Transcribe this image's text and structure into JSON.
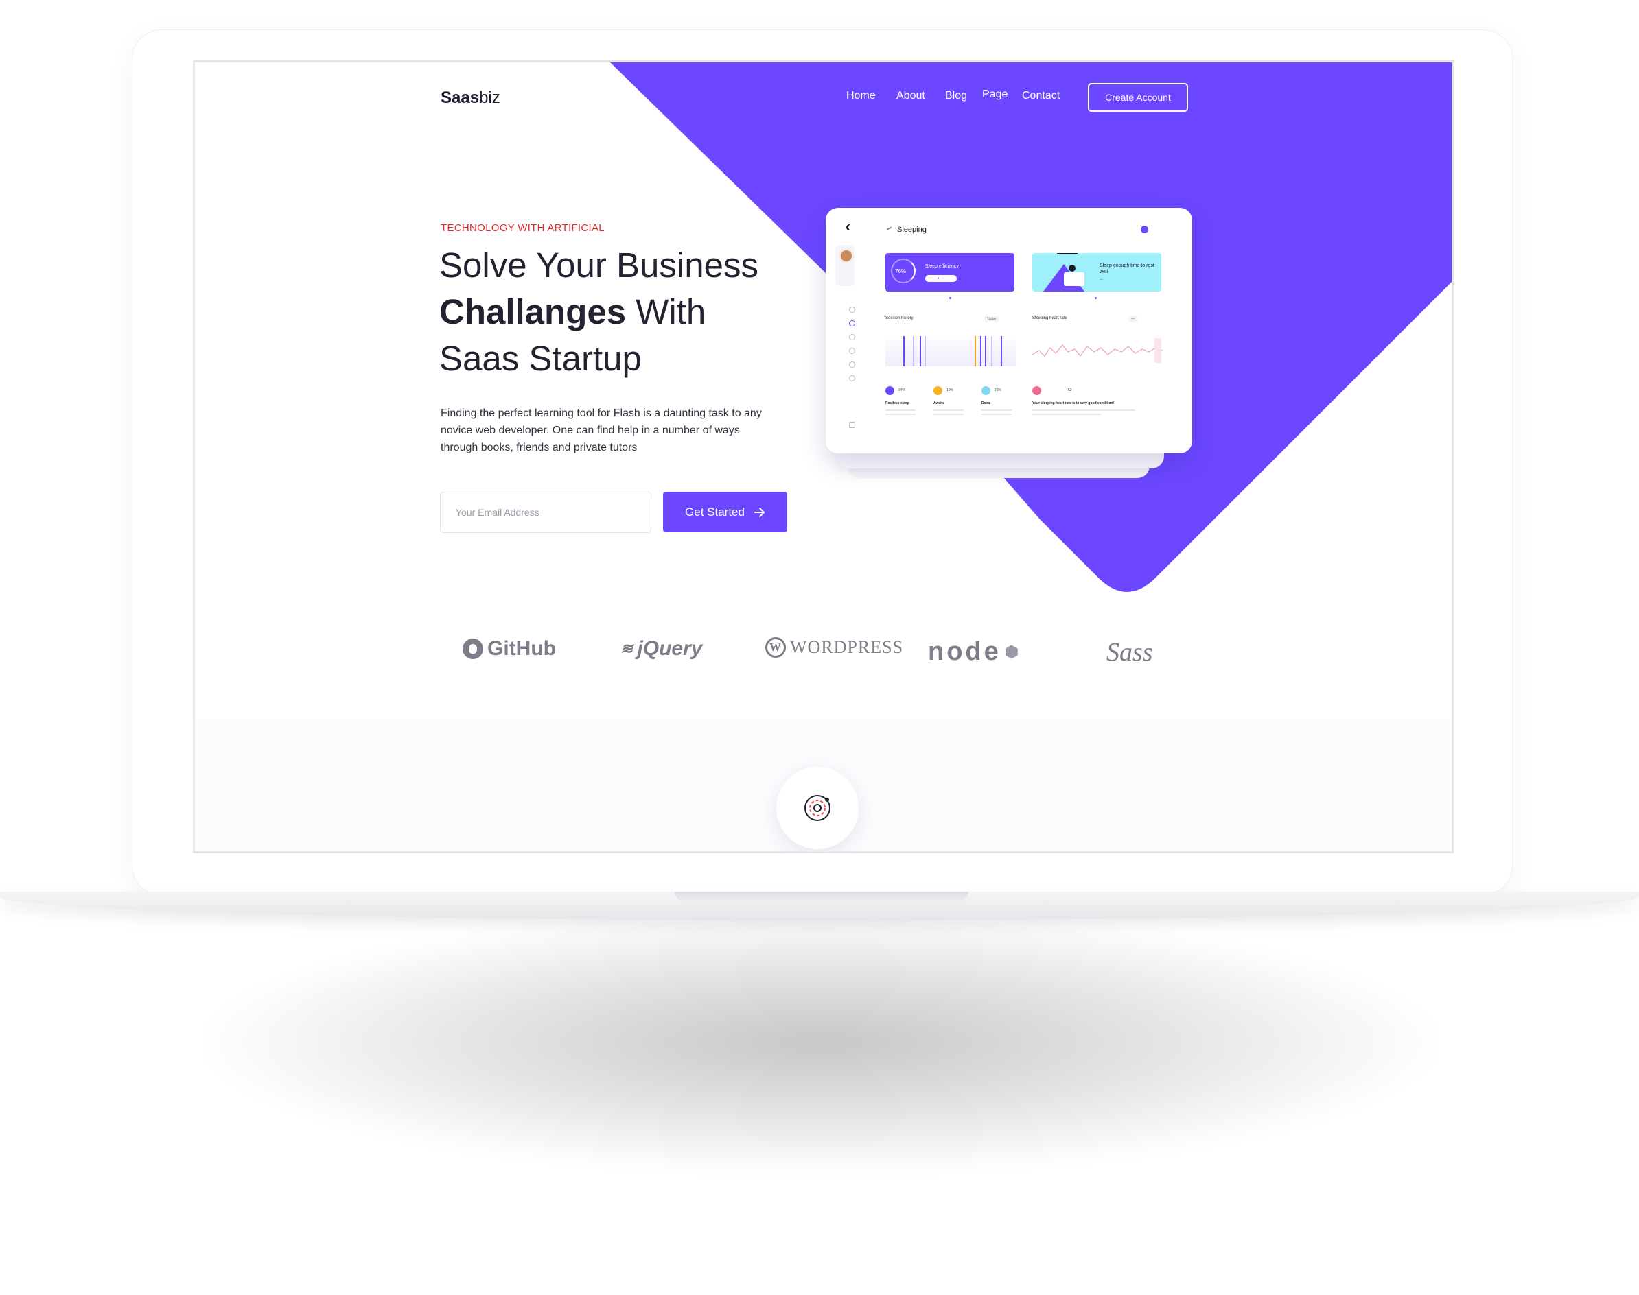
{
  "nav": {
    "logo_bold": "Saas",
    "logo_light": "biz",
    "links": [
      "Home",
      "About",
      "Blog",
      "Page",
      "Contact"
    ],
    "cta_label": "Create Account"
  },
  "hero": {
    "eyebrow": "TECHNOLOGY WITH ARTIFICIAL",
    "title_line1": "Solve Your Business",
    "title_bold": "Challanges",
    "title_line2_rest": " With",
    "title_line3": "Saas Startup",
    "description": "Finding the perfect learning tool for Flash is a daunting task to any novice web developer. One can find help in a number of ways through books, friends and private tutors",
    "email_placeholder": "Your Email Address",
    "button_label": "Get Started"
  },
  "dashboard": {
    "title": "Sleeping",
    "efficiency_value": "76%",
    "efficiency_label": "Sleep efficiency",
    "cyan_label": "Sleep enough time to rest well",
    "session_title": "Session history",
    "session_chip": "Today",
    "heart_title": "Sleeping heart rate",
    "stats": [
      {
        "value": "34%",
        "label": "Restless sleep"
      },
      {
        "value": "10%",
        "label": "Awake"
      },
      {
        "value": "75%",
        "label": "Deep"
      }
    ],
    "heart_avg_value": "52",
    "heart_note": "Your sleeping heart rate is in very good condition!"
  },
  "brands": [
    "GitHub",
    "jQuery",
    "WordPress",
    "node",
    "Sass"
  ],
  "colors": {
    "accent": "#6c47ff",
    "eyebrow": "#e02b2b",
    "text": "#222230"
  }
}
